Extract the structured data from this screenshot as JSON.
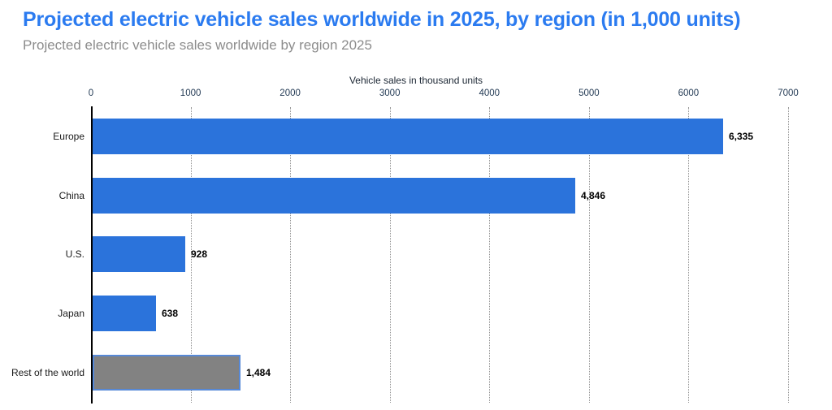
{
  "header": {
    "title": "Projected electric vehicle sales worldwide in 2025, by region (in 1,000 units)",
    "subtitle": "Projected electric vehicle sales worldwide by region 2025"
  },
  "colors": {
    "title": "#2b7bf0",
    "subtitle": "#8c8c8c",
    "axis_title": "#1b2633",
    "tick_label": "#243b55",
    "gridline": "#8f8f8f",
    "zero_axis": "#000000",
    "bar_blue": "#2b73db",
    "bar_gray": "#828282",
    "bar_gray_border": "#5789d7"
  },
  "chart_data": {
    "type": "bar",
    "orientation": "horizontal",
    "title": "Projected electric vehicle sales worldwide in 2025, by region (in 1,000 units)",
    "subtitle": "Projected electric vehicle sales worldwide by region 2025",
    "xlabel": "Vehicle sales in thousand units",
    "ylabel": "",
    "categories": [
      "Europe",
      "China",
      "U.S.",
      "Japan",
      "Rest of the world"
    ],
    "values": [
      6335,
      4846,
      928,
      638,
      1484
    ],
    "value_labels": [
      "6,335",
      "4,846",
      "928",
      "638",
      "1,484"
    ],
    "xlim": [
      0,
      7000
    ],
    "xticks": [
      0,
      1000,
      2000,
      3000,
      4000,
      5000,
      6000,
      7000
    ],
    "grid": "vertical-dotted",
    "legend": "none",
    "bar_colors": [
      "#2b73db",
      "#2b73db",
      "#2b73db",
      "#2b73db",
      "#828282"
    ],
    "bar_border_colors": [
      null,
      null,
      null,
      null,
      "#5789d7"
    ]
  }
}
